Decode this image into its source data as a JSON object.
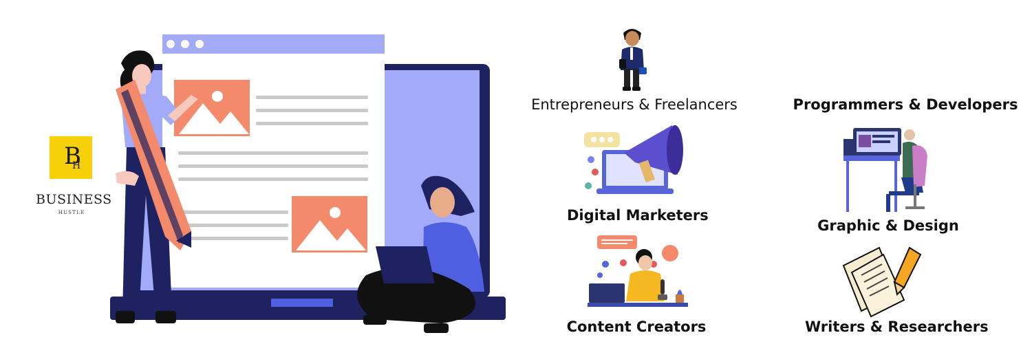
{
  "logo": {
    "monogram_b": "B",
    "monogram_h": "H",
    "name": "BUSINESS",
    "subtitle": "HUSTLE",
    "accent": "#f6d10a"
  },
  "hero_illustration": {
    "icon": "website-design-illustration-icon",
    "colors": {
      "navy": "#1e2260",
      "periwinkle": "#a3aaf7",
      "coral": "#f48a6c",
      "lines": "#c9c9c9"
    }
  },
  "audiences": [
    {
      "label": "Entrepreneurs & Freelancers",
      "icon": "businessman-icon"
    },
    {
      "label": "Programmers & Developers",
      "icon": "developer-desk-icon"
    },
    {
      "label": "Digital Marketers",
      "icon": "megaphone-laptop-icon"
    },
    {
      "label": "Graphic & Design",
      "icon": "developer-desk-icon"
    },
    {
      "label": "Content Creators",
      "icon": "podcaster-icon"
    },
    {
      "label": "Writers & Researchers",
      "icon": "documents-pencil-icon"
    }
  ]
}
